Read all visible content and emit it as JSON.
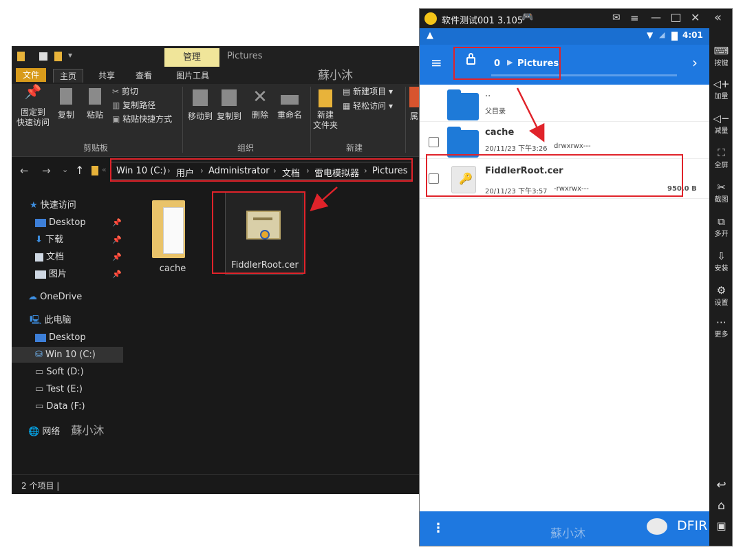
{
  "explorer": {
    "quick_access_icons": [
      "folder-icon",
      "checkbox-icon",
      "folder-icon",
      "dropdown-icon"
    ],
    "tab_manage": "管理",
    "window_title": "Pictures",
    "ribbon_tabs": [
      "文件",
      "主页",
      "共享",
      "查看",
      "图片工具"
    ],
    "watermark": "蘇小沐",
    "clipboard": {
      "pin_label_1": "固定到",
      "pin_label_2": "快速访问",
      "copy": "复制",
      "paste": "粘贴",
      "cut": "剪切",
      "copy_path": "复制路径",
      "paste_shortcut": "粘贴快捷方式",
      "group": "剪贴板"
    },
    "organize": {
      "move_to": "移动到",
      "copy_to": "复制到",
      "delete": "删除",
      "rename": "重命名",
      "group": "组织"
    },
    "new": {
      "new_folder_1": "新建",
      "new_folder_2": "文件夹",
      "new_item": "新建项目 ▾",
      "easy_access": "轻松访问 ▾",
      "group": "新建"
    },
    "partial_button": "属",
    "address_crumbs": [
      "Win 10 (C:)",
      "用户",
      "Administrator",
      "文档",
      "雷电模拟器",
      "Pictures"
    ],
    "nav": {
      "quick_access": "快速访问",
      "desktop_pinned": "Desktop",
      "downloads": "下载",
      "documents": "文档",
      "pictures": "图片",
      "onedrive": "OneDrive",
      "this_pc": "此电脑",
      "desktop": "Desktop",
      "drive_c": "Win 10 (C:)",
      "drive_d": "Soft (D:)",
      "drive_e": "Test (E:)",
      "drive_f": "Data (F:)",
      "network": "网络",
      "network_watermark": "蘇小沐"
    },
    "files": [
      {
        "name": "cache",
        "icon": "folder-icon"
      },
      {
        "name": "FiddlerRoot.cer",
        "icon": "certificate-icon"
      }
    ],
    "status": "2 个项目  |"
  },
  "emulator": {
    "title": "软件测试001 3.105",
    "title_controls": [
      "mail-icon",
      "menu-icon",
      "minimize-icon",
      "maximize-icon",
      "close-icon",
      "collapse-icon"
    ],
    "statusbar": {
      "time": "4:01",
      "warning": "▲"
    },
    "toolbar": {
      "path_root": "0",
      "path_current": "Pictures",
      "forward": "›"
    },
    "rows": [
      {
        "name": "..",
        "meta": "父目录"
      },
      {
        "name": "cache",
        "date": "20/11/23 下午3:26",
        "perms": "drwxrwx---"
      },
      {
        "name": "FiddlerRoot.cer",
        "date": "20/11/23 下午3:57",
        "perms": "-rwxrwx---",
        "size": "950.0 B"
      }
    ],
    "sidebar": [
      {
        "icon": "keyboard-icon",
        "label": "按键"
      },
      {
        "icon": "volume-up-icon",
        "label": "加量"
      },
      {
        "icon": "volume-down-icon",
        "label": "减量"
      },
      {
        "icon": "fullscreen-icon",
        "label": "全屏"
      },
      {
        "icon": "scissors-icon",
        "label": "截图"
      },
      {
        "icon": "multi-instance-icon",
        "label": "多开"
      },
      {
        "icon": "apk-install-icon",
        "label": "安装"
      },
      {
        "icon": "settings-icon",
        "label": "设置"
      },
      {
        "icon": "more-icon",
        "label": "更多"
      }
    ],
    "bottom_watermark": "蘇小沐",
    "brand": "DFIR"
  },
  "accent_colors": {
    "android_blue": "#1e78e0",
    "annotation_red": "#e0232a",
    "file_tab": "#d89b1b"
  }
}
